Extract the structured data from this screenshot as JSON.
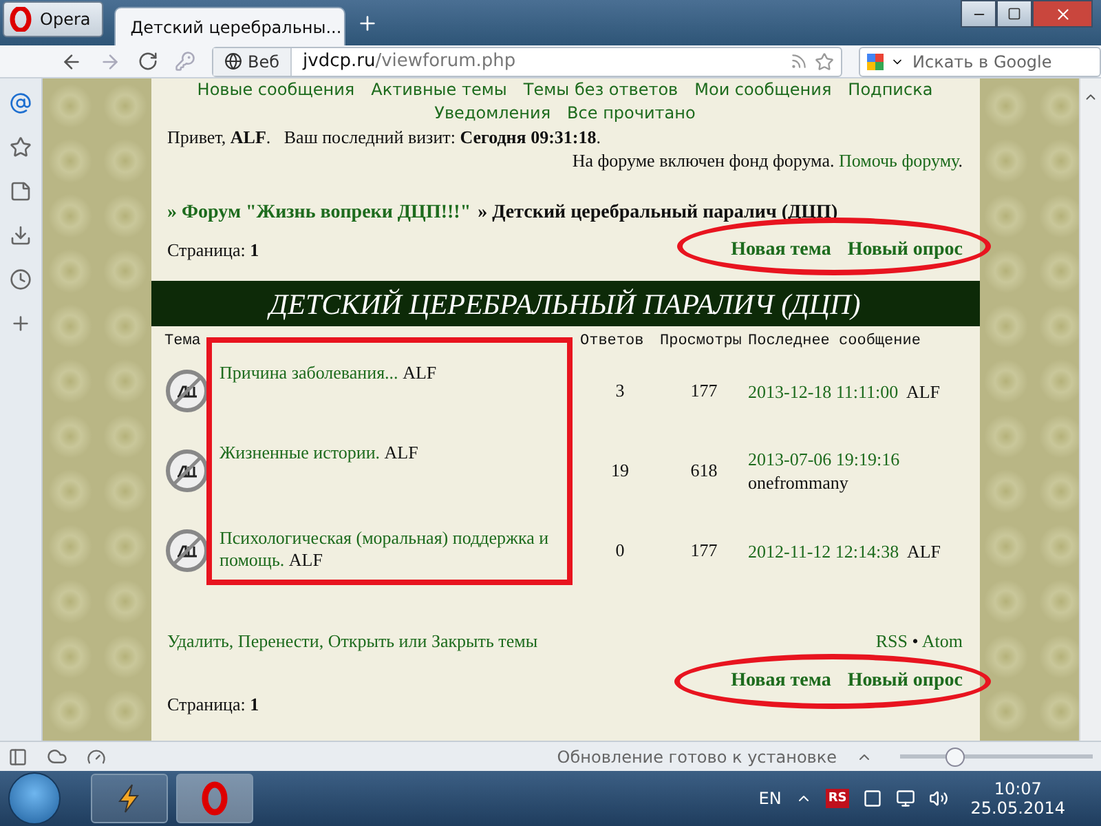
{
  "browser": {
    "menu_button": "Opera",
    "tabs": [
      {
        "title": "Детский церебральны...",
        "selected": true
      }
    ],
    "address": {
      "label": "Веб",
      "domain": "jvdcp.ru",
      "path": "/viewforum.php"
    },
    "search": {
      "placeholder": "Искать в Google"
    }
  },
  "forum": {
    "nav_rows": [
      [
        "Новые сообщения",
        "Активные темы",
        "Темы без ответов",
        "Мои сообщения",
        "Подписка"
      ],
      [
        "Уведомления",
        "Все прочитано"
      ]
    ],
    "greeting": "Привет, **ALF**.   Ваш последний визит: **Сегодня 09:31:18**.",
    "fund": {
      "text": "На форуме включен фонд форума.",
      "link": "Помочь форуму",
      "end": "."
    },
    "breadcrumb": [
      {
        "text": "» Форум \"Жизнь вопреки ДЦП!!!\"",
        "link": true
      },
      {
        "text": "» Детский церебральный паралич (ДЦП)",
        "link": false
      }
    ],
    "page_top": "Страница: **1**",
    "actions_top": [
      "Новая тема",
      "Новый опрос"
    ],
    "section_title": "ДЕТСКИЙ ЦЕРЕБРАЛЬНЫЙ ПАРАЛИЧ (ДЦП)",
    "columns": [
      "Тема",
      "Ответов",
      "Просмотры",
      "Последнее сообщение"
    ],
    "topics": [
      {
        "title": "Причина заболевания...",
        "author": "ALF",
        "replies": "3",
        "views": "177",
        "last_date": "2013-12-18 11:11:00",
        "last_author": "ALF"
      },
      {
        "title": "Жизненные истории.",
        "author": "ALF",
        "replies": "19",
        "views": "618",
        "last_date": "2013-07-06 19:19:16",
        "last_author": "onefrommany"
      },
      {
        "title": "Психологическая (моральная) поддержка и помощь.",
        "author": "ALF",
        "replies": "0",
        "views": "177",
        "last_date": "2012-11-12 12:14:38",
        "last_author": "ALF"
      }
    ],
    "moderator_links": "Удалить, Перенести, Открыть или Закрыть темы",
    "feeds": [
      "RSS",
      "Atom"
    ],
    "feed_separator": "•",
    "actions_bottom": [
      "Новая тема",
      "Новый опрос"
    ],
    "page_bottom": "Страница: **1**"
  },
  "status_bar": {
    "message": "Обновление готово к установке",
    "zoom": {
      "level": 0.28
    }
  },
  "taskbar": {
    "language": "EN",
    "tray_badge": "RS",
    "time": "10:07",
    "date": "25.05.2014"
  }
}
